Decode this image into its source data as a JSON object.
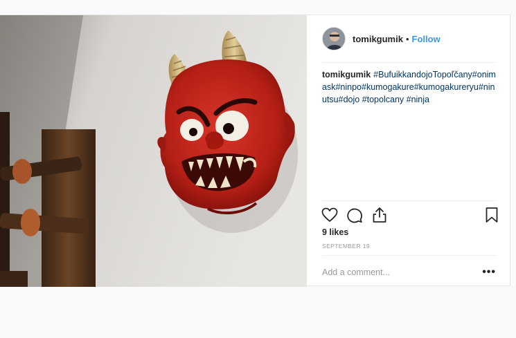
{
  "post": {
    "author": {
      "username": "tomikgumik",
      "separator": "•",
      "follow_label": "Follow"
    },
    "caption": {
      "username": "tomikgumik",
      "text": "#BufuikkandojoTopoľčany#onimask#ninpo#kumogakure#kumogakureryu#ninutsu#dojo #topolcany #ninja"
    },
    "likes": "9 likes",
    "date": "SEPTEMBER 19",
    "comment": {
      "placeholder": "Add a comment...",
      "more_label": "•••"
    },
    "icons": {
      "like": "heart-icon",
      "comment": "comment-icon",
      "share": "share-icon",
      "save": "bookmark-icon",
      "more": "more-options-icon"
    },
    "colors": {
      "link": "#3897f0",
      "hashtag": "#003569",
      "mask_red": "#c0261b"
    }
  }
}
